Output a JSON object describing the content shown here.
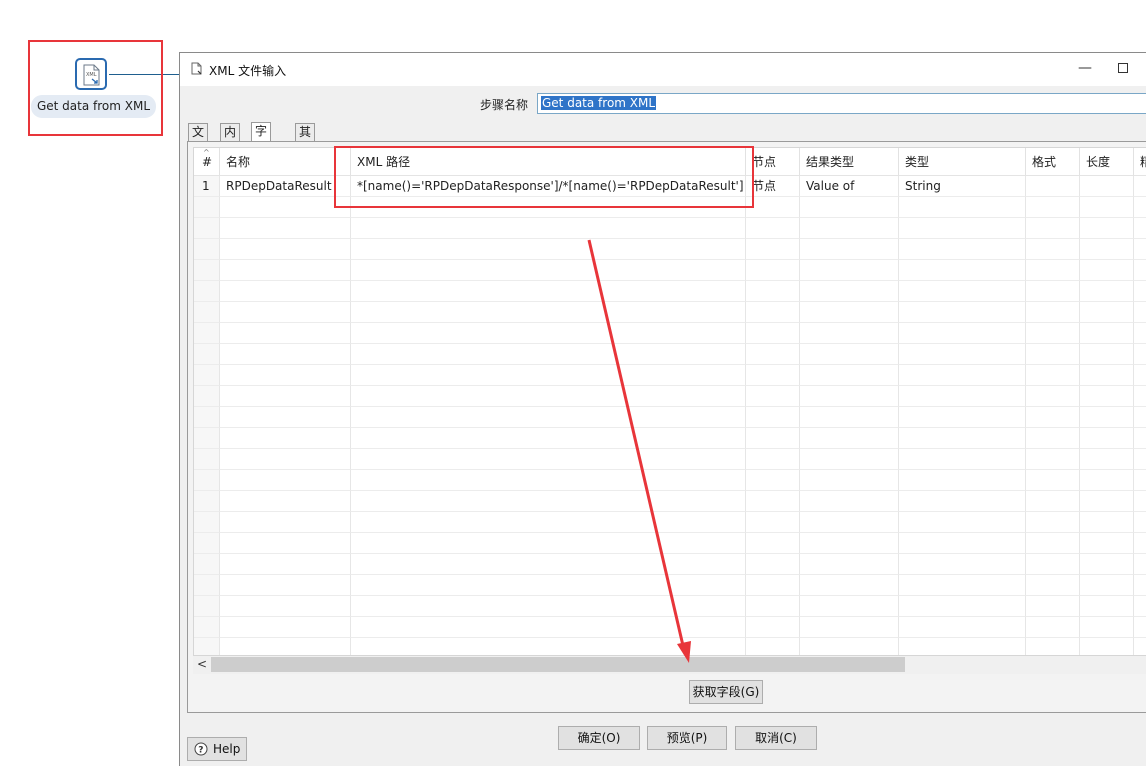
{
  "canvas": {
    "step_icon_text": "XML",
    "step_label": "Get data from XML"
  },
  "dialog": {
    "title": "XML 文件输入",
    "step_name_label": "步骤名称",
    "step_name_value": "Get data from XML",
    "tabs": [
      {
        "label": "文件"
      },
      {
        "label": "内容"
      },
      {
        "label": "字段",
        "active": true
      },
      {
        "label": "其他输出字段"
      }
    ],
    "fields_table": {
      "columns": [
        "#",
        "名称",
        "XML 路径",
        "节点",
        "结果类型",
        "类型",
        "格式",
        "长度",
        "精"
      ],
      "rows": [
        [
          "1",
          "RPDepDataResult",
          "*[name()='RPDepDataResponse']/*[name()='RPDepDataResult']",
          "节点",
          "Value of",
          "String",
          "",
          "",
          ""
        ]
      ]
    },
    "scroll_left_arrow": "<",
    "get_fields_button": "获取字段(G)",
    "help_button": "Help",
    "ok_button": "确定(O)",
    "preview_button": "预览(P)",
    "cancel_button": "取消(C)"
  },
  "colors": {
    "annotation_red": "#e8353a",
    "selection_blue": "#2f74c8",
    "step_icon_blue": "#2a6ab0"
  }
}
